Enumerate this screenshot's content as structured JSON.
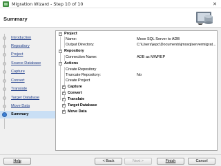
{
  "window": {
    "title": "Migration Wizard - Step 10 of 10",
    "close_glyph": "✕",
    "app_icon": "migration-wizard-icon"
  },
  "header": {
    "title": "Summary",
    "icon": "database-migration-icon"
  },
  "steps": [
    {
      "label": "Introduction"
    },
    {
      "label": "Repository"
    },
    {
      "label": "Project"
    },
    {
      "label": "Source Database"
    },
    {
      "label": "Capture"
    },
    {
      "label": "Convert"
    },
    {
      "label": "Translate"
    },
    {
      "label": "Target Database"
    },
    {
      "label": "Move Data"
    },
    {
      "label": "Summary",
      "active": true
    }
  ],
  "tree": {
    "project": {
      "label": "Project",
      "name_label": "Name:",
      "name_value": "Move SQL Server to ADB",
      "outdir_label": "Output Directory:",
      "outdir_value": "C:\\Users\\jepc\\Documents\\jmssqlservermigrat..."
    },
    "repository": {
      "label": "Repository",
      "conn_label": "Connection Name:",
      "conn_value": "ADB as MWREP"
    },
    "actions": {
      "label": "Actions",
      "create_repo": "Create Repository",
      "truncate_label": "Truncate Repository:",
      "truncate_value": "No",
      "create_project": "Create Project",
      "capture": "Capture",
      "convert": "Convert",
      "translate": "Translate",
      "target_db": "Target Database",
      "move_data": "Move Data"
    },
    "collapse_glyph": "−",
    "expand_glyph": "+"
  },
  "buttons": {
    "help": "Help",
    "back": "< Back",
    "next": "Next >",
    "finish": "Finish",
    "cancel": "Cancel"
  },
  "colors": {
    "active_step_bg": "#c9dff5",
    "link": "#1f3d8a"
  }
}
